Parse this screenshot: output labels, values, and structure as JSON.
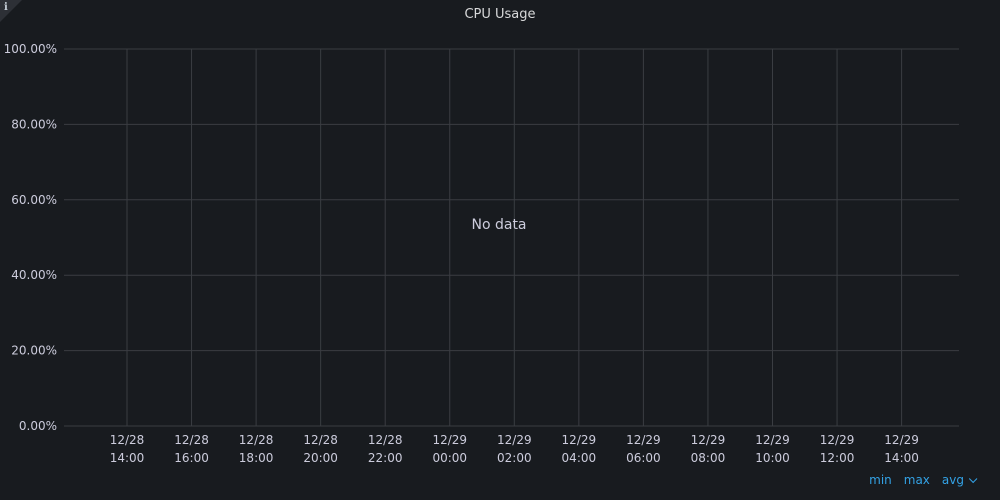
{
  "panel": {
    "title": "CPU Usage",
    "info_icon": "info-icon",
    "info_glyph": "i",
    "no_data_text": "No data"
  },
  "legend_controls": {
    "min_label": "min",
    "max_label": "max",
    "avg_label": "avg",
    "avg_icon": "chevron-down-icon"
  },
  "colors": {
    "background": "#181b1f",
    "grid": "#3a3d42",
    "text": "#ccccdc",
    "link": "#33a2e5"
  },
  "chart_data": {
    "type": "line",
    "title": "CPU Usage",
    "xlabel": "",
    "ylabel": "",
    "series": [],
    "y_ticks": [
      "100.00%",
      "80.00%",
      "60.00%",
      "40.00%",
      "20.00%",
      "0.00%"
    ],
    "ylim": [
      0,
      100
    ],
    "x_ticks": [
      {
        "date": "12/28",
        "time": "14:00"
      },
      {
        "date": "12/28",
        "time": "16:00"
      },
      {
        "date": "12/28",
        "time": "18:00"
      },
      {
        "date": "12/28",
        "time": "20:00"
      },
      {
        "date": "12/28",
        "time": "22:00"
      },
      {
        "date": "12/29",
        "time": "00:00"
      },
      {
        "date": "12/29",
        "time": "02:00"
      },
      {
        "date": "12/29",
        "time": "04:00"
      },
      {
        "date": "12/29",
        "time": "06:00"
      },
      {
        "date": "12/29",
        "time": "08:00"
      },
      {
        "date": "12/29",
        "time": "10:00"
      },
      {
        "date": "12/29",
        "time": "12:00"
      },
      {
        "date": "12/29",
        "time": "14:00"
      }
    ],
    "grid": true,
    "legend": "bottom-right"
  }
}
